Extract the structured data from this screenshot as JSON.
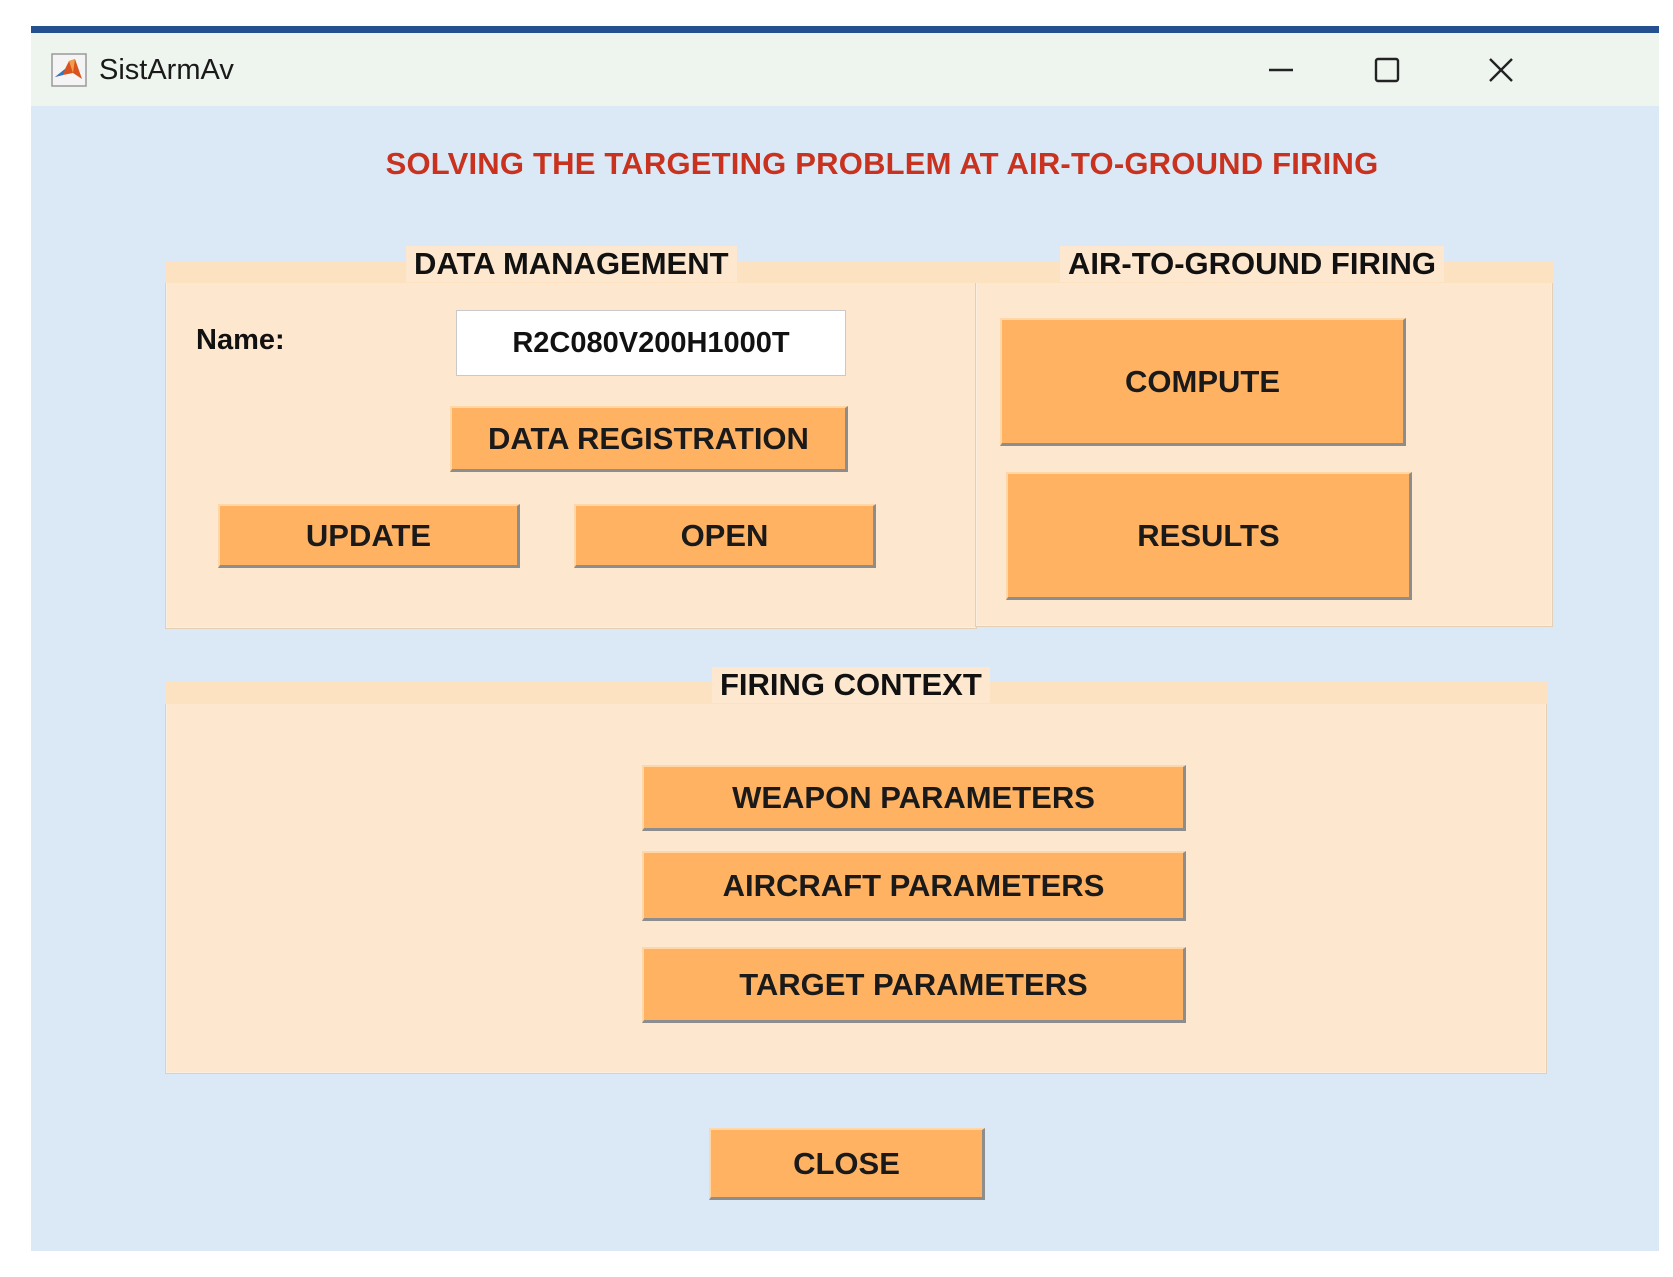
{
  "window": {
    "title": "SistArmAv",
    "controls": [
      "minimize",
      "maximize",
      "close"
    ]
  },
  "heading": "SOLVING THE TARGETING PROBLEM AT AIR-TO-GROUND FIRING",
  "data_management": {
    "title": "DATA MANAGEMENT",
    "name_label": "Name:",
    "name_value": "R2C080V200H1000T",
    "registration_label": "DATA REGISTRATION",
    "update_label": "UPDATE",
    "open_label": "OPEN"
  },
  "air_to_ground": {
    "title": "AIR-TO-GROUND FIRING",
    "compute_label": "COMPUTE",
    "results_label": "RESULTS"
  },
  "firing_context": {
    "title": "FIRING CONTEXT",
    "weapon_label": "WEAPON PARAMETERS",
    "aircraft_label": "AIRCRAFT PARAMETERS",
    "target_label": "TARGET PARAMETERS"
  },
  "close_label": "CLOSE",
  "colors": {
    "background": "#dbe9f7",
    "panel": "#fde7ce",
    "button": "#ffb262",
    "heading": "#c8321e"
  }
}
